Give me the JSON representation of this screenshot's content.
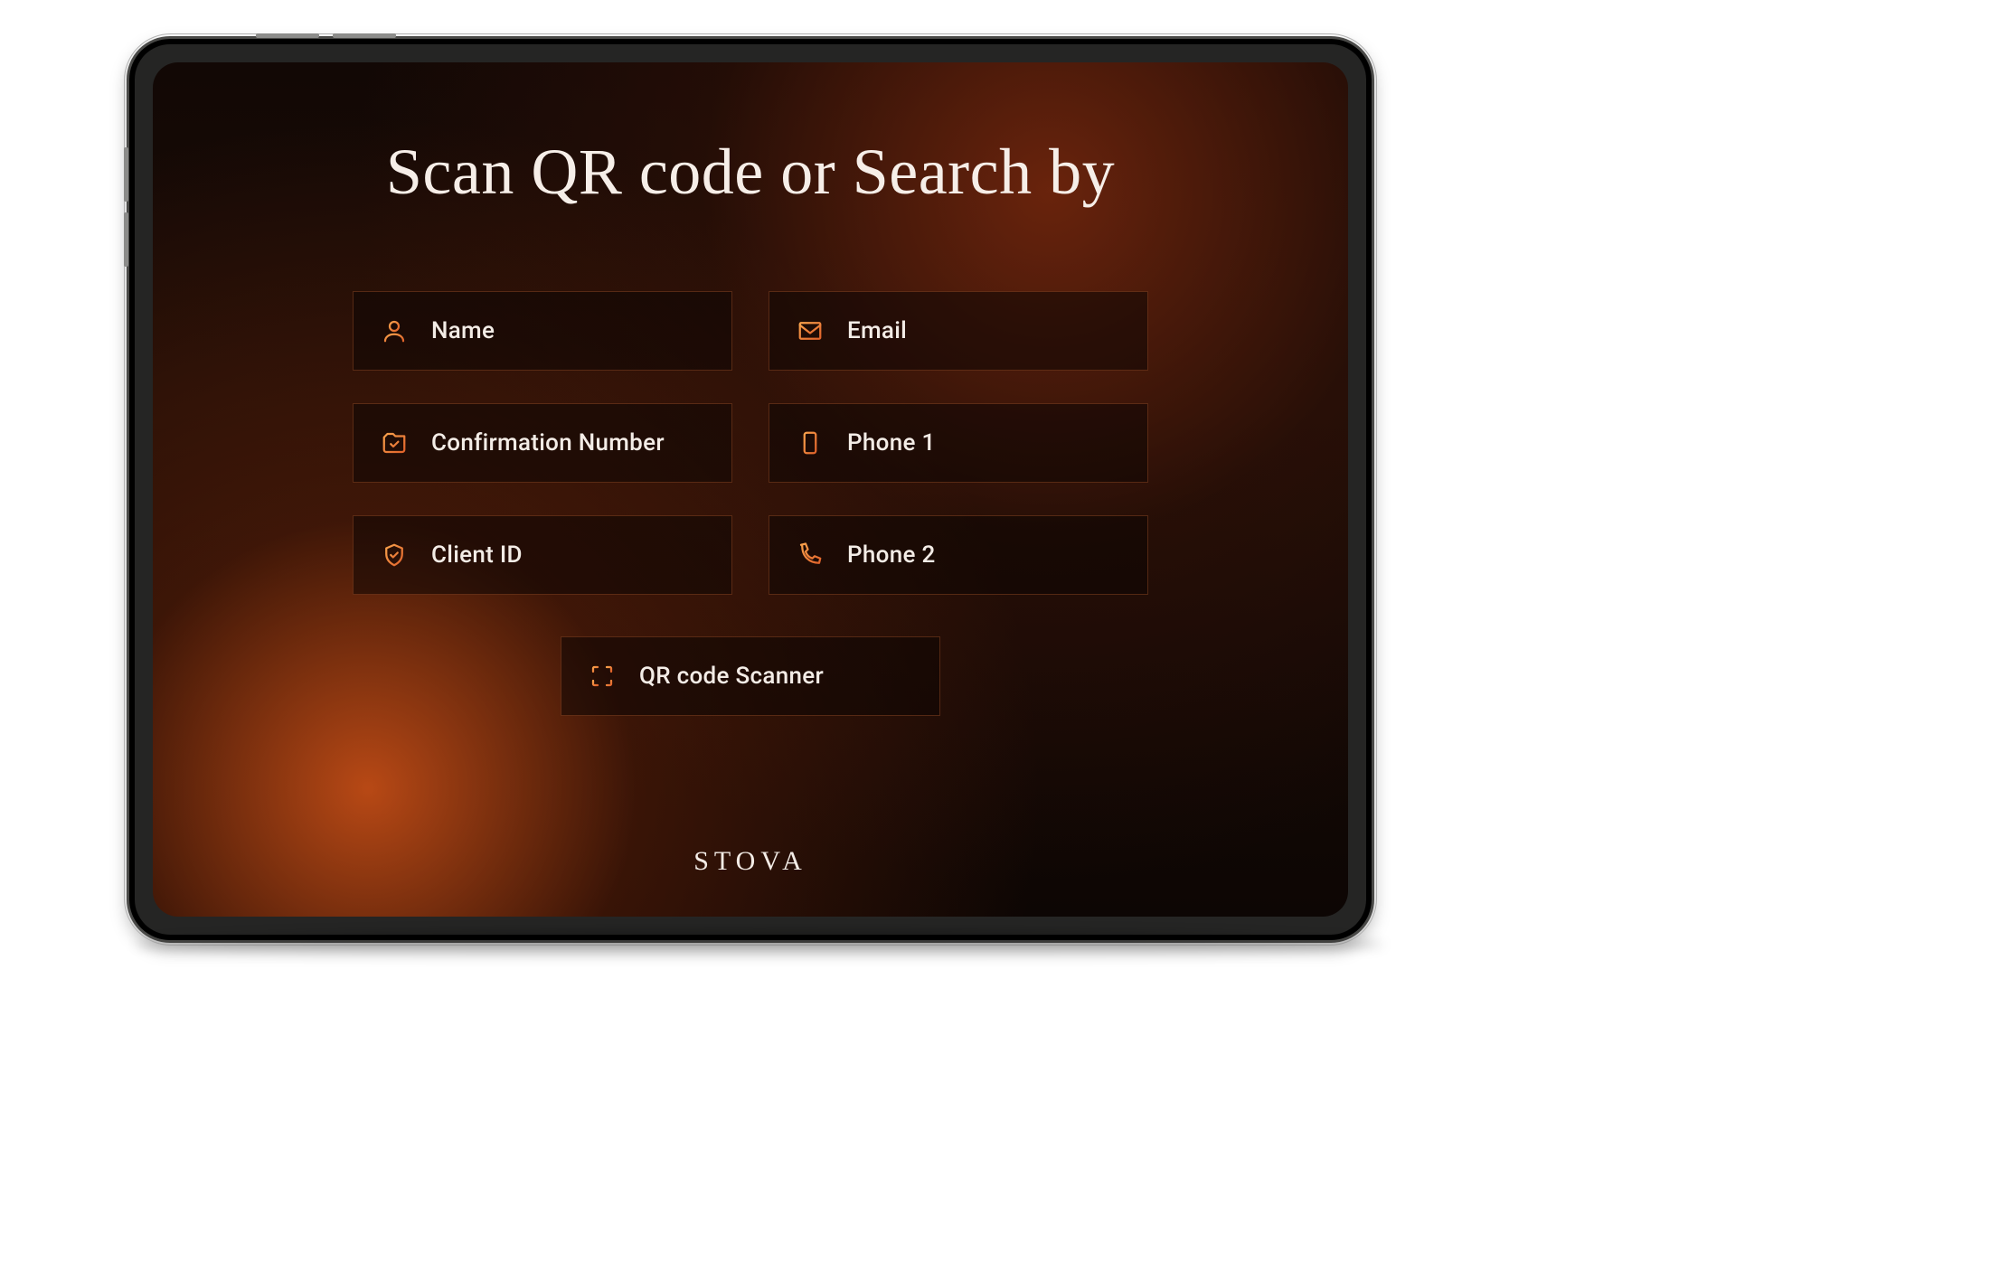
{
  "title": "Scan QR code or Search by",
  "options": [
    {
      "icon": "user-icon",
      "label": "Name"
    },
    {
      "icon": "envelope-icon",
      "label": "Email"
    },
    {
      "icon": "check-folder-icon",
      "label": "Confirmation Number"
    },
    {
      "icon": "smartphone-icon",
      "label": "Phone 1"
    },
    {
      "icon": "shield-check-icon",
      "label": "Client ID"
    },
    {
      "icon": "phone-handset-icon",
      "label": "Phone 2"
    }
  ],
  "scanner": {
    "icon": "qr-brackets-icon",
    "label": "QR code Scanner"
  },
  "brand": "STOVA",
  "colors": {
    "accent_gradient_start": "#f9a24c",
    "accent_gradient_end": "#e0622a",
    "card_border": "rgba(214,110,52,0.32)",
    "card_bg": "rgba(12,6,3,0.55)",
    "text": "#f3ece6"
  }
}
